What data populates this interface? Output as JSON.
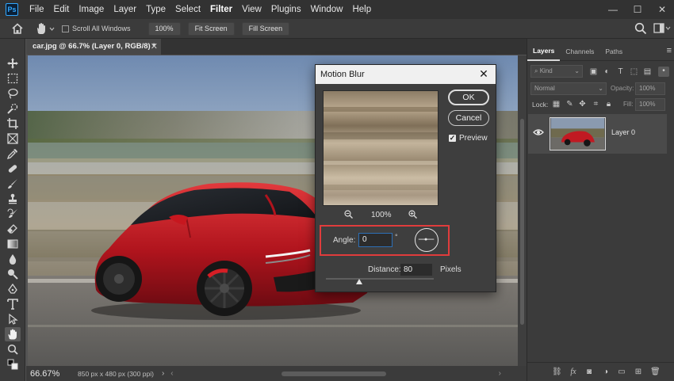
{
  "app": {
    "logo": "Ps",
    "menu": [
      "File",
      "Edit",
      "Image",
      "Layer",
      "Type",
      "Select",
      "Filter",
      "View",
      "Plugins",
      "Window",
      "Help"
    ],
    "active_menu": "Filter"
  },
  "options_bar": {
    "scroll_all_windows": "Scroll All Windows",
    "zoom_button": "100%",
    "fit_screen": "Fit Screen",
    "fill_screen": "Fill Screen"
  },
  "document": {
    "tab_title": "car.jpg @ 66.7% (Layer 0, RGB/8) *"
  },
  "status_bar": {
    "zoom": "66.67%",
    "doc_info": "850 px x 480 px (300 ppi)"
  },
  "layers_panel": {
    "tabs": [
      "Layers",
      "Channels",
      "Paths"
    ],
    "kind_filter": "Kind",
    "blend_mode": "Normal",
    "opacity_label": "Opacity:",
    "opacity_value": "100%",
    "lock_label": "Lock:",
    "fill_label": "Fill:",
    "fill_value": "100%",
    "layers": [
      {
        "name": "Layer 0",
        "visible": true
      }
    ]
  },
  "dialog": {
    "title": "Motion Blur",
    "ok": "OK",
    "cancel": "Cancel",
    "preview_label": "Preview",
    "preview_checked": true,
    "zoom_value": "100%",
    "angle_label": "Angle:",
    "angle_value": "0",
    "degree_symbol": "°",
    "distance_label": "Distance:",
    "distance_value": "80",
    "distance_unit": "Pixels"
  }
}
